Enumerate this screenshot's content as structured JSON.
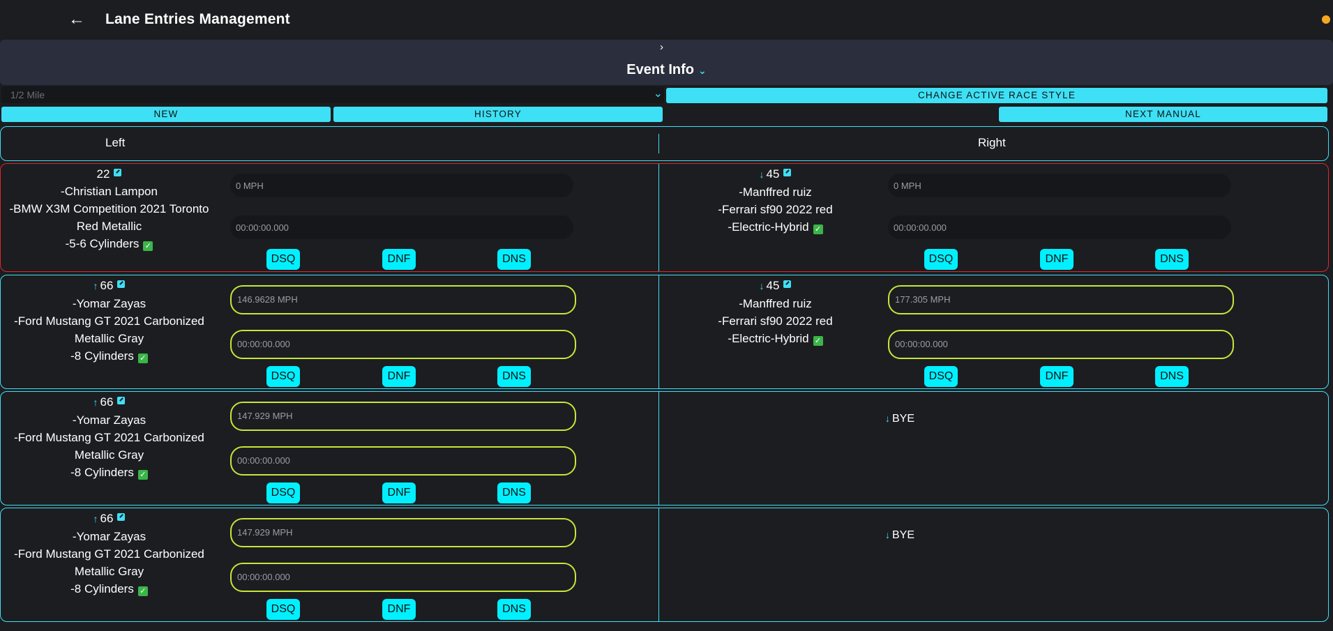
{
  "header": {
    "title": "Lane Entries Management"
  },
  "event_panel": {
    "title": "Event Info"
  },
  "race_style": {
    "selected": "1/2 Mile",
    "change_label": "CHANGE ACTIVE RACE STYLE"
  },
  "actions": {
    "new_label": "NEW",
    "history_label": "HISTORY",
    "next_manual_label": "NEXT MANUAL"
  },
  "lanes": {
    "left": "Left",
    "right": "Right"
  },
  "races": [
    {
      "left": {
        "number": "22",
        "driver": "-Christian Lampon",
        "car": "-BMW X3M Competition 2021 Toronto Red Metallic",
        "engine": "-5-6 Cylinders",
        "speed": "0 MPH",
        "time": "00:00:00.000"
      },
      "right": {
        "number": "45",
        "driver": "-Manffred ruiz",
        "car": "-Ferrari sf90 2022 red",
        "engine": "-Electric-Hybrid",
        "speed": "0 MPH",
        "time": "00:00:00.000"
      }
    },
    {
      "left": {
        "number": "66",
        "driver": "-Yomar Zayas",
        "car": "-Ford Mustang GT 2021 Carbonized Metallic Gray",
        "engine": "-8 Cylinders",
        "speed": "146.9628 MPH",
        "time": "00:00:00.000"
      },
      "right": {
        "number": "45",
        "driver": "-Manffred ruiz",
        "car": "-Ferrari sf90 2022 red",
        "engine": "-Electric-Hybrid",
        "speed": "177.305 MPH",
        "time": "00:00:00.000"
      }
    },
    {
      "left": {
        "number": "66",
        "driver": "-Yomar Zayas",
        "car": "-Ford Mustang GT 2021 Carbonized Metallic Gray",
        "engine": "-8 Cylinders",
        "speed": "147.929 MPH",
        "time": "00:00:00.000"
      },
      "right": {
        "bye": "BYE"
      }
    },
    {
      "left": {
        "number": "66",
        "driver": "-Yomar Zayas",
        "car": "-Ford Mustang GT 2021 Carbonized Metallic Gray",
        "engine": "-8 Cylinders",
        "speed": "147.929 MPH",
        "time": "00:00:00.000"
      },
      "right": {
        "bye": "BYE"
      }
    }
  ],
  "status_buttons": {
    "dsq": "DSQ",
    "dnf": "DNF",
    "dns": "DNS"
  },
  "icons": {
    "back": "arrow-left-icon",
    "edit": "edit-icon",
    "check": "check-icon",
    "up": "arrow-up-icon",
    "down": "arrow-down-icon",
    "status": "status-dot-icon"
  },
  "colors": {
    "accent": "#3ee0f5",
    "active_border": "#e0262a",
    "filled_field": "#c6e63a",
    "status_dot": "#f5a623"
  }
}
